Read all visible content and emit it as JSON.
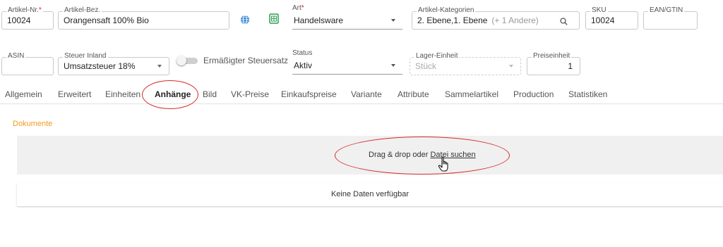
{
  "row1": {
    "artikel_nr": {
      "label": "Artikel-Nr.",
      "required": "*",
      "value": "10024"
    },
    "artikel_bez": {
      "label": "Artikel-Bez.",
      "value": "Orangensaft 100% Bio"
    },
    "art": {
      "label": "Art",
      "required": "*",
      "value": "Handelsware"
    },
    "artikel_kategorien": {
      "label": "Artikel-Kategorien",
      "value": "2. Ebene,1. Ebene",
      "extra": "(+ 1 Andere)"
    },
    "sku": {
      "label": "SKU",
      "value": "10024"
    },
    "ean": {
      "label": "EAN/GTIN",
      "value": ""
    }
  },
  "row2": {
    "asin": {
      "label": "ASIN",
      "value": ""
    },
    "steuer": {
      "label": "Steuer Inland",
      "value": "Umsatzsteuer 18%"
    },
    "ermaessigt": {
      "label": "Ermäßigter Steuersatz",
      "on": false
    },
    "status": {
      "label": "Status",
      "value": "Aktiv"
    },
    "lager": {
      "label": "Lager-Einheit",
      "placeholder": "Stück"
    },
    "preiseinheit": {
      "label": "Preiseinheit",
      "value": "1"
    }
  },
  "tabs": [
    {
      "label": "Allgemein"
    },
    {
      "label": "Erweitert"
    },
    {
      "label": "Einheiten"
    },
    {
      "label": "Anhänge",
      "active": true
    },
    {
      "label": "Bild"
    },
    {
      "label": "VK-Preise"
    },
    {
      "label": "Einkaufspreise"
    },
    {
      "label": "Variante"
    },
    {
      "label": "Attribute"
    },
    {
      "label": "Sammelartikel"
    },
    {
      "label": "Production"
    },
    {
      "label": "Statistiken"
    }
  ],
  "dokumente": {
    "section_label": "Dokumente",
    "drop_prefix": "Drag & drop oder",
    "drop_link": "Datei suchen",
    "empty_text": "Keine Daten verfügbar"
  },
  "colors": {
    "required": "#e02020",
    "section_label": "#f19a1f",
    "annotation": "#d42a2a",
    "globe_icon": "#1e78d2",
    "excel_icon": "#2e9e4f"
  },
  "icons": {
    "globe": "globe-icon",
    "excel": "excel-icon",
    "search": "search-icon",
    "cursor": "hand-pointer-icon"
  }
}
